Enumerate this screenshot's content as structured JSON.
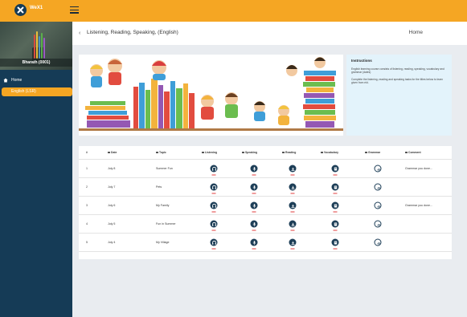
{
  "app": {
    "brand": "WeX1",
    "logo_icon": "x-logo-icon"
  },
  "colors": {
    "topbar": "#f5a623",
    "sidebar": "#153b56",
    "active": "#f5a623",
    "icon_dark": "#1d3e57",
    "underline": "#e03b3b"
  },
  "sidebar": {
    "profile_name": "Bharath (0001)",
    "home_label": "Home",
    "active_label": "English (LSR)"
  },
  "header": {
    "back_icon": "chevron-left-icon",
    "title": "Listening, Reading, Speaking, (English)",
    "breadcrumb": "Home"
  },
  "instructions": {
    "title": "Instructions",
    "p1": "English learning course consists of listening, reading, speaking, vocabulary and grammar (dates)",
    "p2": "Complete the listening, reading and speaking tasks for the titles below to learn given from eld."
  },
  "table": {
    "headers": {
      "num": "#",
      "date": "Date",
      "topic": "Topic",
      "listening": "Listening",
      "speaking": "Speaking",
      "reading": "Reading",
      "vocabulary": "Vocabulary",
      "grammar": "Grammar",
      "comment": "Comment"
    },
    "rows": [
      {
        "num": "1",
        "date": "July 8",
        "topic": "Summer Fun",
        "comment": "Grammar you done..."
      },
      {
        "num": "2",
        "date": "July 7",
        "topic": "Pets",
        "comment": ""
      },
      {
        "num": "3",
        "date": "July 6",
        "topic": "My Family",
        "comment": "Grammar you done..."
      },
      {
        "num": "4",
        "date": "July 5",
        "topic": "Fun in Summer",
        "comment": ""
      },
      {
        "num": "5",
        "date": "July 4",
        "topic": "My Village",
        "comment": ""
      }
    ]
  }
}
